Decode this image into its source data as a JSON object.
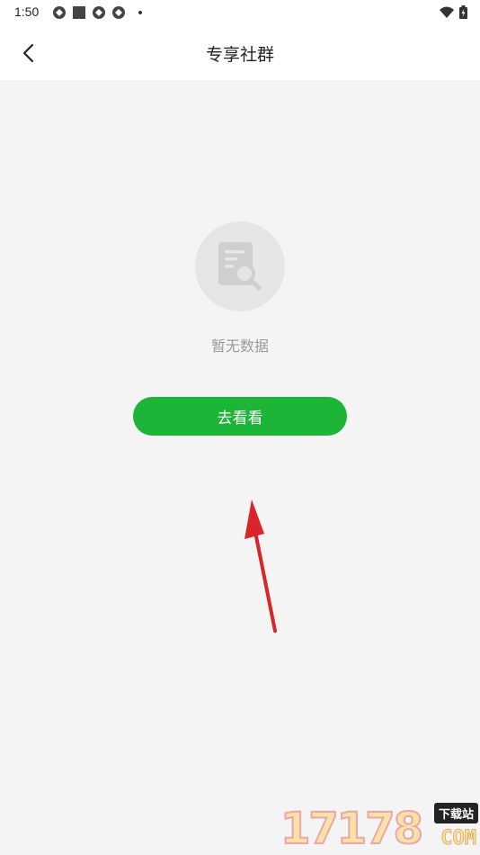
{
  "status_bar": {
    "time": "1:50"
  },
  "nav": {
    "title": "专享社群"
  },
  "empty_state": {
    "message": "暂无数据",
    "icon": "document-search-icon"
  },
  "action": {
    "button_label": "去看看"
  },
  "colors": {
    "accent": "#1db537",
    "annotation_arrow": "#d9252a"
  },
  "watermark": {
    "digits": "17178",
    "tag": "下载站",
    "suffix": "COM"
  }
}
